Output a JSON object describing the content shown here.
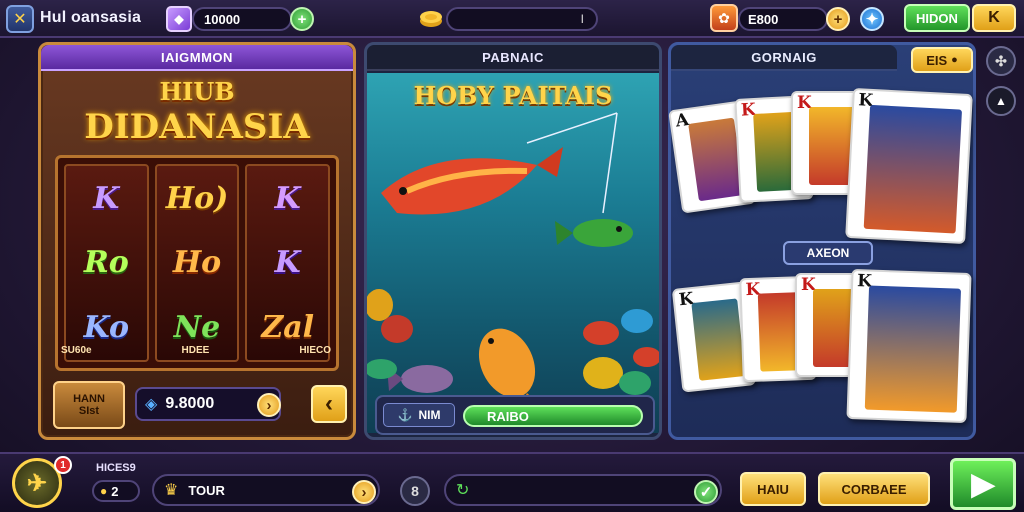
{
  "header": {
    "brand": "Hul oansasia",
    "gem_balance": "10000",
    "add_symbol": "+",
    "center_value": "I",
    "coins": "E800",
    "mode_button": "HIDON",
    "back_symbol": "K"
  },
  "slot": {
    "heading": "IAIGMMON",
    "logo_line1": "HIUB",
    "logo_line2": "DIDANASIA",
    "reels": [
      [
        "K",
        "Ro",
        "Ko"
      ],
      [
        "Ho)",
        "Ho",
        "Ne"
      ],
      [
        "K",
        "K",
        "Zal"
      ]
    ],
    "reel_footers": [
      "SU60e",
      "HDEE",
      "HIECO"
    ],
    "bet_label_line1": "HANN",
    "bet_label_line2": "SIst",
    "bet_value": "9.8000",
    "arrow_symbol": "›",
    "spin_symbol": "‹"
  },
  "fishing": {
    "heading": "PABNAIC",
    "title": "HOBY PAITAIS",
    "tag_label": "NIM",
    "score": "RAIBO"
  },
  "cards": {
    "heading": "GORNAIG",
    "bet_button": "EIS",
    "mid_label": "AXEON",
    "top_row": [
      "A",
      "K",
      "K",
      "K"
    ],
    "bottom_row": [
      "K",
      "K",
      "K",
      "K"
    ]
  },
  "footer": {
    "notification_count": "1",
    "label": "HICES9",
    "count": "2",
    "tour_label": "TOUR",
    "chat_symbol": "8",
    "button_a": "HAIU",
    "button_b": "CORBAEE"
  },
  "colors": {
    "accent_purple": "#8e56d8",
    "accent_gold": "#ffd44a",
    "accent_green": "#36b34a"
  }
}
